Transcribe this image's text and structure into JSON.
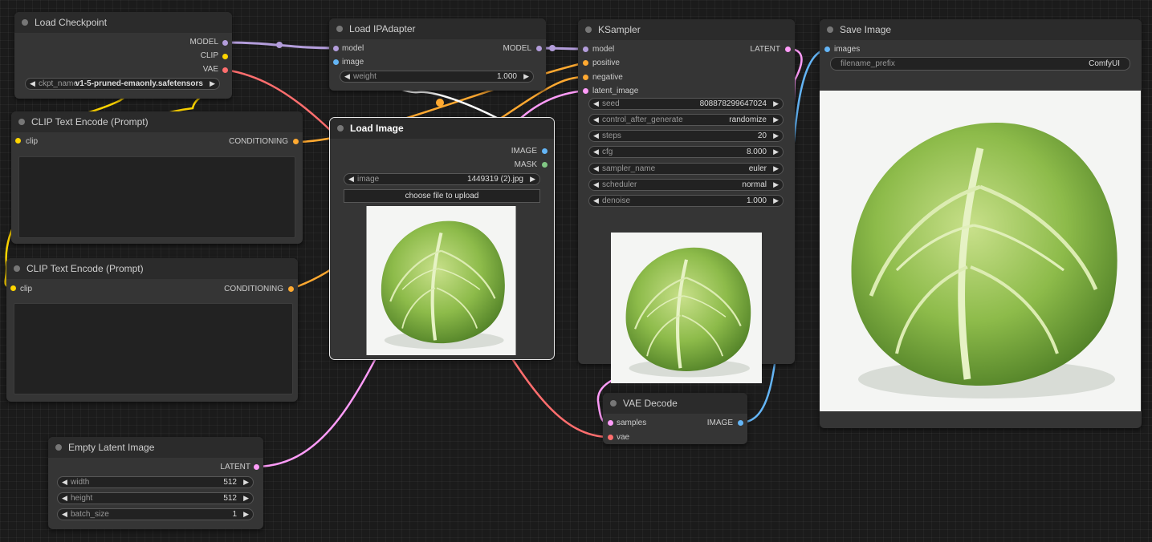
{
  "colors": {
    "model": "#b39ddb",
    "clip": "#ffd500",
    "vae": "#ff6e6e",
    "conditioning": "#ffa931",
    "latent": "#ff9cf9",
    "image": "#64b5f6",
    "mask": "#81c784"
  },
  "nodes": {
    "load_checkpoint": {
      "title": "Load Checkpoint",
      "outputs": [
        "MODEL",
        "CLIP",
        "VAE"
      ],
      "ckpt_name_label": "ckpt_name",
      "ckpt_name_value": "v1-5-pruned-emaonly.safetensors"
    },
    "clip_text_1": {
      "title": "CLIP Text Encode (Prompt)",
      "input": "clip",
      "output": "CONDITIONING"
    },
    "clip_text_2": {
      "title": "CLIP Text Encode (Prompt)",
      "input": "clip",
      "output": "CONDITIONING"
    },
    "load_ipadapter": {
      "title": "Load IPAdapter",
      "inputs": [
        "model",
        "image"
      ],
      "output": "MODEL",
      "weight_label": "weight",
      "weight_value": "1.000"
    },
    "load_image": {
      "title": "Load Image",
      "outputs": [
        "IMAGE",
        "MASK"
      ],
      "image_label": "image",
      "image_value": "1449319 (2).jpg",
      "upload_button": "choose file to upload"
    },
    "ksampler": {
      "title": "KSampler",
      "inputs": [
        "model",
        "positive",
        "negative",
        "latent_image"
      ],
      "output": "LATENT",
      "widgets": [
        {
          "label": "seed",
          "value": "808878299647024"
        },
        {
          "label": "control_after_generate",
          "value": "randomize"
        },
        {
          "label": "steps",
          "value": "20"
        },
        {
          "label": "cfg",
          "value": "8.000"
        },
        {
          "label": "sampler_name",
          "value": "euler"
        },
        {
          "label": "scheduler",
          "value": "normal"
        },
        {
          "label": "denoise",
          "value": "1.000"
        }
      ]
    },
    "save_image": {
      "title": "Save Image",
      "input": "images",
      "prefix_label": "filename_prefix",
      "prefix_value": "ComfyUI"
    },
    "vae_decode": {
      "title": "VAE Decode",
      "inputs": [
        "samples",
        "vae"
      ],
      "output": "IMAGE"
    },
    "empty_latent": {
      "title": "Empty Latent Image",
      "output": "LATENT",
      "widgets": [
        {
          "label": "width",
          "value": "512"
        },
        {
          "label": "height",
          "value": "512"
        },
        {
          "label": "batch_size",
          "value": "1"
        }
      ]
    }
  }
}
